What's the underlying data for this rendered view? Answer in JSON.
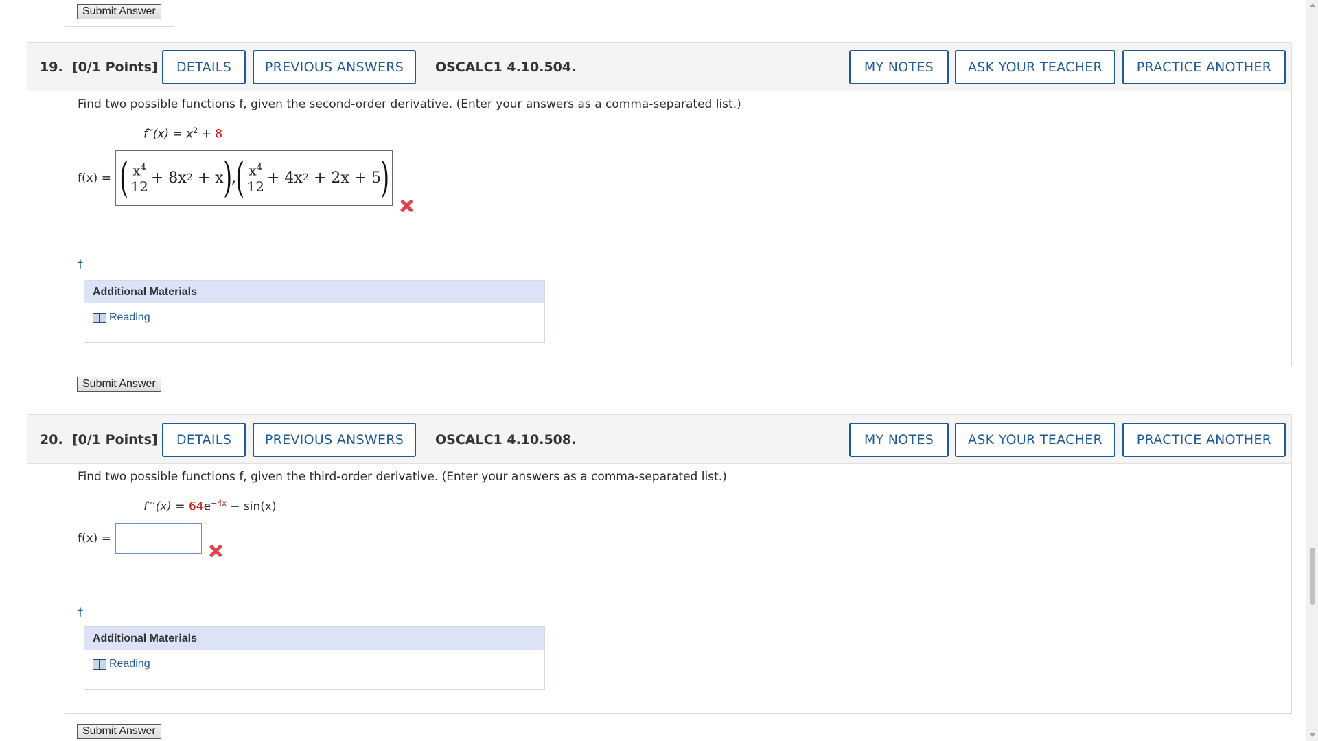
{
  "top_submit": {
    "label": "Submit Answer"
  },
  "q19": {
    "number": "19.",
    "points": "[0/1 Points]",
    "details": "DETAILS",
    "previous_answers": "PREVIOUS ANSWERS",
    "code": "OSCALC1 4.10.504.",
    "my_notes": "MY NOTES",
    "ask_teacher": "ASK YOUR TEACHER",
    "practice_another": "PRACTICE ANOTHER",
    "prompt": "Find two possible functions f, given the second-order derivative. (Enter your answers as a comma-separated list.)",
    "formula_lhs": "f′′(x) = x",
    "formula_exp": "2",
    "formula_mid": " + ",
    "formula_red": "8",
    "answer_label": "f(x) =",
    "answer_status": "incorrect",
    "answer": {
      "f1_num": "x",
      "f1_num_exp": "4",
      "f1_den": "12",
      "f1_rest_a": "+ 8x",
      "f1_rest_a_exp": "2",
      "f1_rest_b": "+ x",
      "sep": ",",
      "f2_num": "x",
      "f2_num_exp": "4",
      "f2_den": "12",
      "f2_rest_a": "+ 4x",
      "f2_rest_a_exp": "2",
      "f2_rest_b": "+ 2x + 5"
    },
    "dagger": "†",
    "materials_title": "Additional Materials",
    "reading_link": "Reading",
    "submit": "Submit Answer"
  },
  "q20": {
    "number": "20.",
    "points": "[0/1 Points]",
    "details": "DETAILS",
    "previous_answers": "PREVIOUS ANSWERS",
    "code": "OSCALC1 4.10.508.",
    "my_notes": "MY NOTES",
    "ask_teacher": "ASK YOUR TEACHER",
    "practice_another": "PRACTICE ANOTHER",
    "prompt": "Find two possible functions f, given the third-order derivative. (Enter your answers as a comma-separated list.)",
    "formula_lhs": "f′′′(x) = ",
    "formula_red": "64",
    "formula_e": "e",
    "formula_exp": "−4x",
    "formula_rest": " − sin(x)",
    "answer_label": "f(x) =",
    "answer_value": "",
    "answer_status": "incorrect",
    "dagger": "†",
    "materials_title": "Additional Materials",
    "reading_link": "Reading",
    "submit": "Submit Answer"
  },
  "colors": {
    "accent": "#1f5a96",
    "error": "#e0434b",
    "materials_header": "#dde3f7"
  },
  "icons": {
    "incorrect": "close-icon",
    "reading": "book-icon"
  }
}
